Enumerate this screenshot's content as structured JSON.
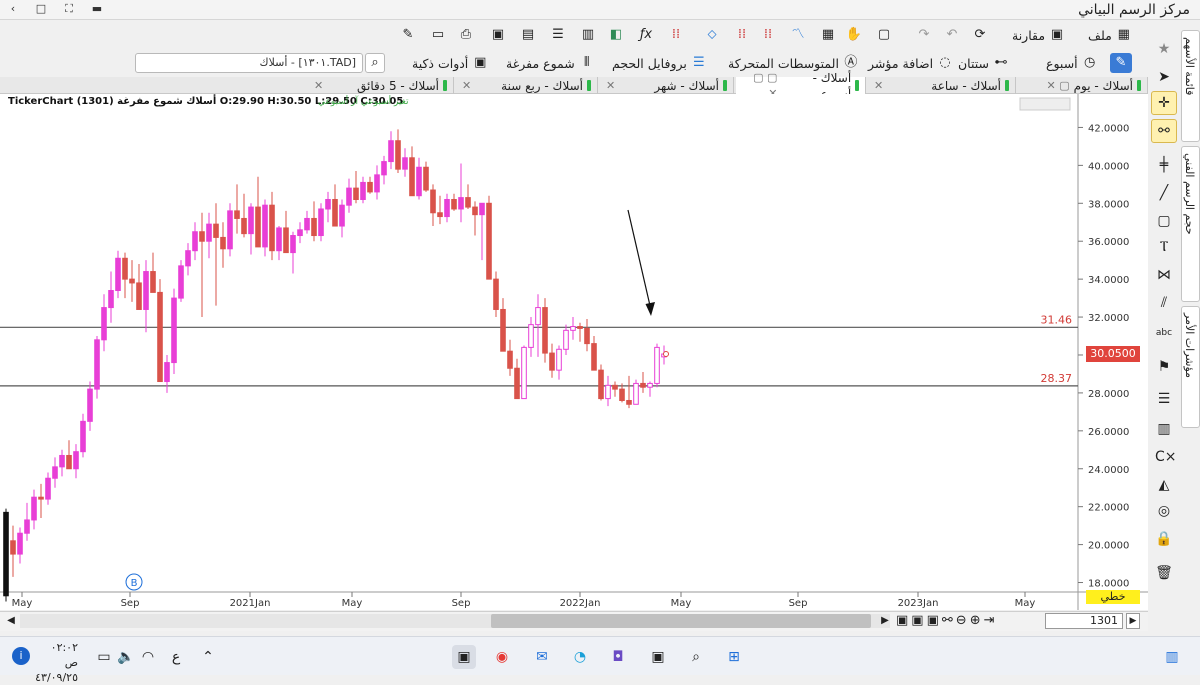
{
  "window": {
    "title": "مركز الرسم البياني",
    "buttons": [
      "‹",
      "□",
      "⛶",
      "▬"
    ]
  },
  "toolbar1": [
    {
      "label": "ملف",
      "icon": "chart-icon"
    },
    {
      "label": "مقارنة",
      "icon": "compare-icon"
    },
    {
      "label": "",
      "icon": "refresh-icon"
    },
    {
      "label": "",
      "icon": "undo-icon"
    },
    {
      "label": "",
      "icon": "redo-icon"
    }
  ],
  "toolbar2": [
    {
      "label": "أسبوع",
      "icon": "clock-icon"
    },
    {
      "label": "ستتان",
      "icon": "link-icon"
    },
    {
      "label": "اضافة مؤشر",
      "icon": "indicator-icon"
    },
    {
      "label": "المتوسطات المتحركة",
      "icon": "ma-icon"
    },
    {
      "label": "بروفايل الحجم",
      "icon": "volume-profile-icon"
    },
    {
      "label": "شموع مفرغة",
      "icon": "candles-icon"
    },
    {
      "label": "أدوات ذكية",
      "icon": "smart-tools-icon"
    }
  ],
  "search": {
    "value": "[TAD.١٣٠١] - أسلاك"
  },
  "tabs": [
    {
      "label": "أسلاك - يوم",
      "active": false
    },
    {
      "label": "أسلاك - ساعة",
      "active": false
    },
    {
      "label": "أسلاك - أسبوع",
      "active": true
    },
    {
      "label": "أسلاك - شهر",
      "active": false
    },
    {
      "label": "أسلاك - ربع سنة",
      "active": false
    },
    {
      "label": "أسلاك - 5 دقائق",
      "active": false
    }
  ],
  "chart_info": {
    "brand": "TickerChart",
    "ohlc": "أسلاك شموع مفرغة (1301) O:29.90 H:30.50 L:29.50 C:30.05",
    "sub": "تغير أسبوعي  آر أسبوعي"
  },
  "price_box": "30.0500",
  "line_type": "خطي",
  "marker_b": "B",
  "level_labels": [
    "31.46",
    "28.37"
  ],
  "zoom_value": "1301",
  "colors": {
    "bull": "#e83fd6",
    "bear": "#d9534a",
    "level": "#555555",
    "price_label_bg": "#e0443c"
  },
  "side_tools": [
    "star-icon",
    "cursor-icon",
    "crosshair-icon",
    "link-icon",
    "cross-lines-icon",
    "trendline-icon",
    "rectangle-icon",
    "channel-icon",
    "pattern-icon",
    "fib-icon",
    "text-icon",
    "flag-icon",
    "list-icon",
    "calc-icon",
    "cx-icon",
    "fill-icon",
    "eye-off-icon",
    "lock-icon",
    "trash-icon"
  ],
  "vertical_tabs": [
    "قائمة الأسهم",
    "حجم الرسم الفني",
    "مؤشرات الأمر"
  ],
  "taskbar": {
    "time": "٠٢:٠٢ ص",
    "date": "٤٣/٠٩/٢٥",
    "lang": "ع"
  },
  "chart_data": {
    "type": "candlestick",
    "title": "",
    "ylim": [
      17.5,
      43.5
    ],
    "y_ticks": [
      "42.0000",
      "40.0000",
      "38.0000",
      "36.0000",
      "34.0000",
      "32.0000",
      "30.0000",
      "28.0000",
      "26.0000",
      "24.0000",
      "22.0000",
      "20.0000",
      "18.0000"
    ],
    "x_ticks": [
      "May",
      "Sep",
      "2021Jan",
      "May",
      "Sep",
      "2022Jan",
      "May",
      "Sep",
      "2023Jan",
      "May"
    ],
    "horizontal_levels": [
      31.46,
      28.37
    ],
    "candles": [
      [
        17.3,
        21.9,
        17.0,
        21.7
      ],
      [
        20.2,
        21.0,
        18.3,
        19.5
      ],
      [
        19.5,
        20.9,
        19.0,
        20.6
      ],
      [
        20.6,
        22.2,
        20.2,
        21.3
      ],
      [
        21.3,
        22.9,
        20.8,
        22.5
      ],
      [
        22.5,
        23.2,
        21.4,
        22.4
      ],
      [
        22.4,
        23.8,
        22.1,
        23.5
      ],
      [
        23.5,
        24.6,
        23.0,
        24.1
      ],
      [
        24.1,
        25.0,
        23.6,
        24.7
      ],
      [
        24.7,
        25.5,
        24.2,
        24.0
      ],
      [
        24.0,
        25.3,
        23.5,
        24.9
      ],
      [
        24.9,
        26.9,
        24.6,
        26.5
      ],
      [
        26.5,
        28.6,
        26.0,
        28.2
      ],
      [
        28.2,
        31.0,
        27.7,
        30.8
      ],
      [
        30.8,
        33.2,
        30.2,
        32.5
      ],
      [
        32.5,
        34.4,
        31.7,
        33.4
      ],
      [
        33.4,
        35.5,
        33.0,
        35.1
      ],
      [
        35.1,
        35.4,
        33.0,
        34.0
      ],
      [
        34.0,
        35.0,
        32.8,
        33.8
      ],
      [
        33.8,
        34.8,
        33.0,
        32.4
      ],
      [
        32.4,
        35.0,
        31.2,
        34.4
      ],
      [
        34.4,
        35.4,
        33.8,
        33.3
      ],
      [
        33.3,
        34.0,
        31.0,
        28.6
      ],
      [
        28.6,
        30.0,
        28.0,
        29.6
      ],
      [
        29.6,
        33.5,
        29.0,
        33.0
      ],
      [
        33.0,
        35.0,
        32.8,
        34.7
      ],
      [
        34.7,
        35.9,
        34.2,
        35.5
      ],
      [
        35.5,
        37.0,
        35.0,
        36.5
      ],
      [
        36.5,
        37.5,
        32.0,
        36.0
      ],
      [
        36.0,
        37.5,
        35.1,
        36.9
      ],
      [
        36.9,
        38.0,
        32.6,
        36.2
      ],
      [
        36.2,
        37.0,
        34.6,
        35.6
      ],
      [
        35.6,
        38.0,
        35.2,
        37.6
      ],
      [
        37.6,
        39.0,
        36.4,
        37.2
      ],
      [
        37.2,
        38.5,
        36.2,
        36.4
      ],
      [
        36.4,
        38.0,
        35.3,
        37.8
      ],
      [
        37.8,
        39.4,
        37.0,
        35.7
      ],
      [
        35.7,
        38.2,
        35.2,
        37.9
      ],
      [
        37.9,
        38.6,
        35.0,
        35.5
      ],
      [
        35.5,
        36.8,
        35.0,
        36.7
      ],
      [
        36.7,
        37.6,
        35.6,
        35.4
      ],
      [
        35.4,
        36.5,
        34.3,
        36.3
      ],
      [
        36.3,
        37.0,
        35.9,
        36.6
      ],
      [
        36.6,
        37.6,
        36.4,
        37.2
      ],
      [
        37.2,
        38.1,
        36.0,
        36.3
      ],
      [
        36.3,
        38.0,
        36.0,
        37.7
      ],
      [
        37.7,
        38.6,
        37.0,
        38.2
      ],
      [
        38.2,
        39.0,
        37.1,
        36.8
      ],
      [
        36.8,
        38.2,
        36.2,
        37.9
      ],
      [
        37.9,
        39.3,
        37.5,
        38.8
      ],
      [
        38.8,
        39.7,
        38.0,
        38.2
      ],
      [
        38.2,
        39.4,
        38.0,
        39.1
      ],
      [
        39.1,
        39.4,
        38.5,
        38.6
      ],
      [
        38.6,
        40.0,
        38.2,
        39.5
      ],
      [
        39.5,
        40.5,
        39.0,
        40.2
      ],
      [
        40.2,
        41.8,
        39.8,
        41.3
      ],
      [
        41.3,
        41.9,
        39.6,
        39.8
      ],
      [
        39.8,
        40.9,
        39.4,
        40.4
      ],
      [
        40.4,
        41.0,
        38.8,
        38.4
      ],
      [
        38.4,
        40.4,
        38.2,
        39.9
      ],
      [
        39.9,
        40.2,
        38.6,
        38.7
      ],
      [
        38.7,
        39.0,
        36.8,
        37.5
      ],
      [
        37.5,
        38.4,
        36.9,
        37.3
      ],
      [
        37.3,
        38.5,
        37.0,
        38.2
      ],
      [
        38.2,
        38.5,
        37.6,
        37.7
      ],
      [
        37.7,
        40.1,
        37.0,
        38.3
      ],
      [
        38.3,
        39.0,
        37.7,
        37.8
      ],
      [
        37.8,
        38.1,
        36.3,
        37.4
      ],
      [
        37.4,
        37.8,
        35.0,
        38.0
      ],
      [
        38.0,
        38.4,
        34.0,
        34.0
      ],
      [
        34.0,
        34.4,
        32.0,
        32.4
      ],
      [
        32.4,
        33.0,
        30.5,
        30.2
      ],
      [
        30.2,
        30.8,
        28.9,
        29.3
      ],
      [
        29.3,
        29.8,
        27.9,
        27.7
      ],
      [
        27.7,
        30.5,
        27.7,
        30.4
      ],
      [
        30.4,
        32.0,
        29.9,
        31.6
      ],
      [
        31.6,
        33.2,
        29.9,
        32.5
      ],
      [
        32.5,
        33.0,
        29.6,
        30.1
      ],
      [
        30.1,
        30.6,
        28.8,
        29.2
      ],
      [
        29.2,
        30.5,
        28.7,
        30.3
      ],
      [
        30.3,
        31.6,
        30.0,
        31.3
      ],
      [
        31.3,
        32.0,
        30.8,
        31.5
      ],
      [
        31.5,
        31.7,
        30.7,
        31.4
      ],
      [
        31.4,
        31.9,
        30.2,
        30.6
      ],
      [
        30.6,
        31.0,
        29.8,
        29.2
      ],
      [
        29.2,
        29.5,
        27.6,
        27.7
      ],
      [
        27.7,
        28.9,
        27.3,
        28.4
      ],
      [
        28.4,
        28.6,
        27.8,
        28.2
      ],
      [
        28.2,
        28.5,
        27.5,
        27.6
      ],
      [
        27.6,
        28.9,
        27.2,
        27.4
      ],
      [
        27.4,
        28.7,
        27.4,
        28.5
      ],
      [
        28.5,
        29.1,
        28.0,
        28.3
      ],
      [
        28.3,
        28.6,
        27.8,
        28.5
      ],
      [
        28.5,
        30.6,
        28.3,
        30.4
      ],
      [
        29.9,
        30.5,
        29.5,
        30.05
      ]
    ],
    "annotation": "arrow pointing to top of last candle near 31.46"
  }
}
